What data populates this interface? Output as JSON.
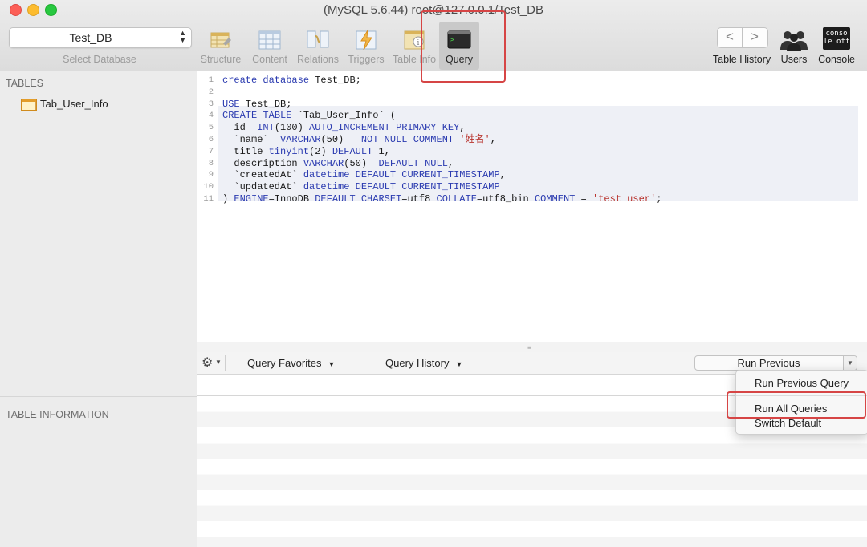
{
  "window": {
    "title": "(MySQL 5.6.44) root@127.0.0.1/Test_DB"
  },
  "toolbar": {
    "database_select": {
      "value": "Test_DB",
      "caption": "Select Database"
    },
    "buttons": [
      {
        "label": "Structure",
        "icon": "structure-icon"
      },
      {
        "label": "Content",
        "icon": "content-icon"
      },
      {
        "label": "Relations",
        "icon": "relations-icon"
      },
      {
        "label": "Triggers",
        "icon": "triggers-icon"
      },
      {
        "label": "Table Info",
        "icon": "table-info-icon"
      },
      {
        "label": "Query",
        "icon": "query-terminal-icon",
        "active": true
      }
    ],
    "history": {
      "label": "Table History",
      "back": "<",
      "forward": ">"
    },
    "users": {
      "label": "Users"
    },
    "console": {
      "label": "Console",
      "icon_text": [
        "conso",
        "le off"
      ]
    }
  },
  "sidebar": {
    "tables_heading": "TABLES",
    "tables": [
      "Tab_User_Info"
    ],
    "table_info_heading": "TABLE INFORMATION"
  },
  "editor": {
    "lines": [
      "create database Test_DB;",
      "",
      "USE Test_DB;",
      "CREATE TABLE `Tab_User_Info` (",
      "  id  INT(100) AUTO_INCREMENT PRIMARY KEY,",
      "  `name`  VARCHAR(50)   NOT NULL COMMENT '姓名',",
      "  title tinyint(2) DEFAULT 1,",
      "  description VARCHAR(50)  DEFAULT NULL,",
      "  `createdAt` datetime DEFAULT CURRENT_TIMESTAMP,",
      "  `updatedAt` datetime DEFAULT CURRENT_TIMESTAMP",
      ") ENGINE=InnoDB DEFAULT CHARSET=utf8 COLLATE=utf8_bin COMMENT = 'test user';"
    ]
  },
  "query_bar": {
    "favorites": "Query Favorites",
    "history": "Query History",
    "run_button": "Run Previous"
  },
  "run_menu": {
    "items": [
      "Run Previous Query",
      "Run All Queries",
      "Switch Default"
    ]
  },
  "colors": {
    "annotation": "#d64545",
    "keyword": "#2b3bb0",
    "string": "#b8322c"
  }
}
